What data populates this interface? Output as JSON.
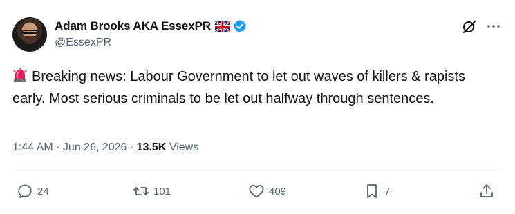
{
  "user": {
    "display_name": "Adam Brooks AKA EssexPR",
    "handle": "@EssexPR"
  },
  "icons": {
    "avatar": "profile-photo",
    "flag": "uk-flag-icon",
    "verified": "verified-badge-icon",
    "grok": "grok-icon",
    "more": "more-icon",
    "siren": "siren-emoji-icon"
  },
  "tweet": {
    "text": "Breaking news:  Labour Government to let out waves of killers & rapists early. Most serious criminals to be let out halfway through sentences."
  },
  "meta": {
    "time": "1:44 AM",
    "separator": " · ",
    "date": "Jun 26, 2026",
    "views_count": "13.5K",
    "views_label": " Views"
  },
  "actions": {
    "replies": "24",
    "retweets": "101",
    "likes": "409",
    "bookmarks": "7"
  },
  "colors": {
    "text": "#0f1419",
    "secondary": "#536471",
    "verified": "#1d9bf0",
    "divider": "#eff3f4"
  }
}
